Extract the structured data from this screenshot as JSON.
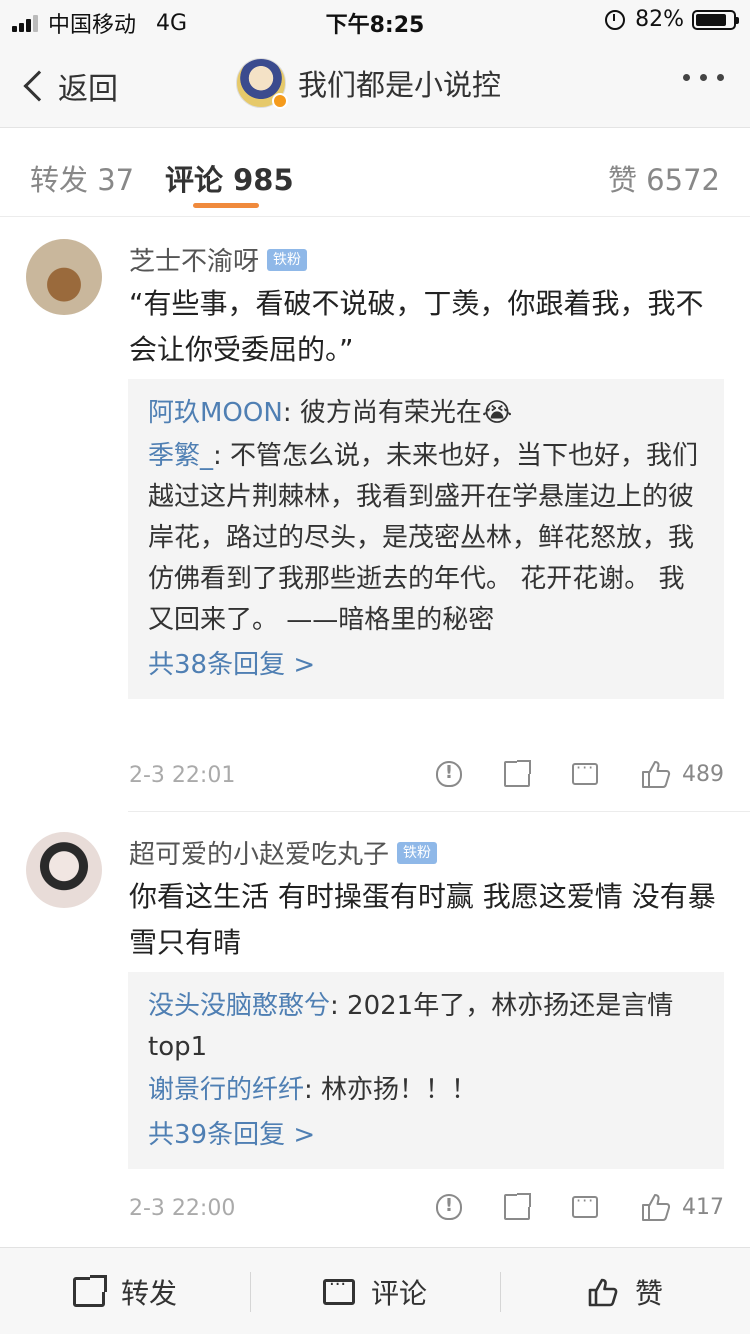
{
  "status_bar": {
    "carrier": "中国移动",
    "network": "4G",
    "time": "下午8:25",
    "battery_percent": "82%",
    "battery_level": 0.82
  },
  "nav": {
    "back_label": "返回",
    "title": "我们都是小说控"
  },
  "tabs": {
    "repost": "转发 37",
    "comment": "评论 985",
    "like": "赞 6572"
  },
  "comments": [
    {
      "username": "芝士不渝呀",
      "badge": "铁粉",
      "text": "“有些事，看破不说破，丁羡，你跟着我，我不会让你受委屈的。”",
      "replies": [
        {
          "who": "阿玖MOON",
          "text": ": 彼方尚有荣光在😭"
        },
        {
          "who": "季繁_",
          "text": ": 不管怎么说，未来也好，当下也好，我们越过这片荆棘林，我看到盛开在学悬崖边上的彼岸花，路过的尽头，是茂密丛林，鲜花怒放，我仿佛看到了我那些逝去的年代。 花开花谢。 我又回来了。 ——暗格里的秘密"
        }
      ],
      "more_replies": "共38条回复 >",
      "time": "2-3 22:01",
      "likes": "489"
    },
    {
      "username": "超可爱的小赵爱吃丸子",
      "badge": "铁粉",
      "text": "你看这生活 有时操蛋有时赢 我愿这爱情 没有暴雪只有晴",
      "replies": [
        {
          "who": "没头没脑憨憨兮",
          "text": ": 2021年了，林亦扬还是言情top1"
        },
        {
          "who": "谢景行的纤纤",
          "text": ": 林亦扬！！！"
        }
      ],
      "more_replies": "共39条回复 >",
      "time": "2-3 22:00",
      "likes": "417"
    }
  ],
  "bottom_bar": {
    "repost": "转发",
    "comment": "评论",
    "like": "赞"
  },
  "colors": {
    "accent": "#f08a3c",
    "link": "#4f7fb3",
    "fan_badge": "#8fb8e8"
  }
}
